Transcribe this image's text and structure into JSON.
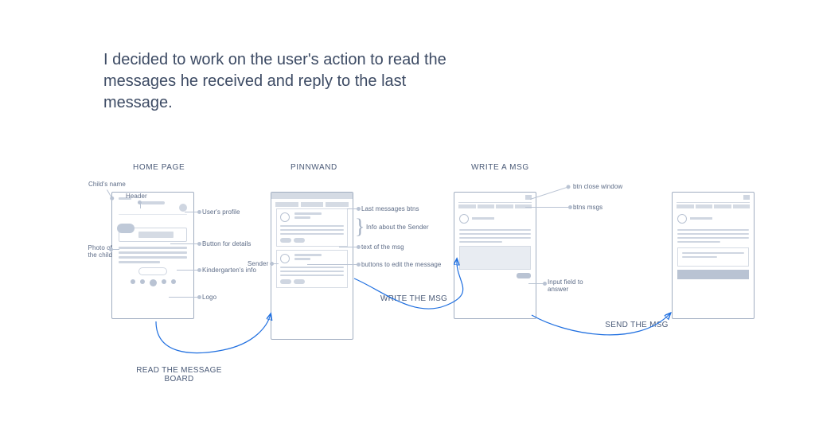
{
  "intro": "I decided to work on the user's action to read the messages he received and reply to the last message.",
  "titles": {
    "home": "HOME PAGE",
    "pinnwand": "PINNWAND",
    "write": "WRITE A MSG"
  },
  "labels": {
    "childs_name": "Child's name",
    "header": "Header",
    "users_profile": "User's profile",
    "button_for_details": "Button for details",
    "photo_of_the_child": "Photo of the child",
    "kindergartens_info": "Kindergarten's info",
    "logo": "Logo",
    "sender": "Sender",
    "last_messages_btns": "Last messages btns",
    "info_about_the_sender": "Info about the Sender",
    "text_of_the_msg": "text of the msg",
    "buttons_to_edit_the_message": "buttons to edit the message",
    "btn_close_window": "btn close window",
    "btns_msgs": "btns msgs",
    "input_field_to_answer": "Input field to answer"
  },
  "flows": {
    "read_board": "READ THE MESSAGE BOARD",
    "write_msg": "WRITE THE MSG",
    "send_msg": "SEND THE MSG"
  }
}
